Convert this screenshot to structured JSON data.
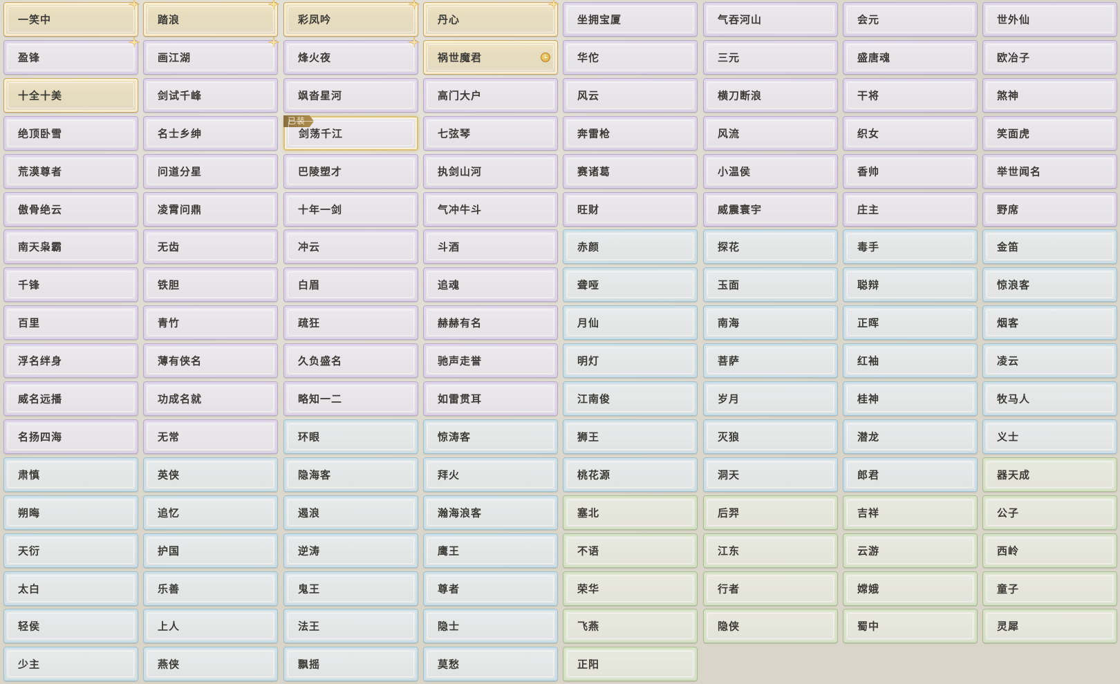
{
  "icons": {
    "sparkle": "sparkle-icon",
    "timer": "clock-icon"
  },
  "equipped_label": "已装",
  "colors": {
    "gold": "#caa563",
    "purple": "#b9a9c9",
    "blue": "#9fbfcd",
    "green": "#a8bd92",
    "badge": "#8a6f3d"
  },
  "titles": [
    {
      "label": "一笑中",
      "rarity": "gold",
      "sparkle": true
    },
    {
      "label": "踏浪",
      "rarity": "gold",
      "sparkle": true
    },
    {
      "label": "彩凤吟",
      "rarity": "gold",
      "sparkle": true
    },
    {
      "label": "丹心",
      "rarity": "gold",
      "sparkle": true
    },
    {
      "label": "坐拥宝厦",
      "rarity": "purple"
    },
    {
      "label": "气吞河山",
      "rarity": "purple"
    },
    {
      "label": "会元",
      "rarity": "purple"
    },
    {
      "label": "世外仙",
      "rarity": "purple"
    },
    {
      "label": "盈锋",
      "rarity": "purple",
      "sparkle": true
    },
    {
      "label": "画江湖",
      "rarity": "purple",
      "sparkle": true
    },
    {
      "label": "烽火夜",
      "rarity": "purple",
      "sparkle": true
    },
    {
      "label": "祸世魔君",
      "rarity": "gold",
      "timer": true
    },
    {
      "label": "华佗",
      "rarity": "purple"
    },
    {
      "label": "三元",
      "rarity": "purple"
    },
    {
      "label": "盛唐魂",
      "rarity": "purple"
    },
    {
      "label": "欧冶子",
      "rarity": "purple"
    },
    {
      "label": "十全十美",
      "rarity": "gold"
    },
    {
      "label": "剑试千峰",
      "rarity": "purple"
    },
    {
      "label": "飒沓星河",
      "rarity": "purple"
    },
    {
      "label": "高门大户",
      "rarity": "purple"
    },
    {
      "label": "风云",
      "rarity": "purple"
    },
    {
      "label": "横刀断浪",
      "rarity": "purple"
    },
    {
      "label": "干将",
      "rarity": "purple"
    },
    {
      "label": "煞神",
      "rarity": "purple"
    },
    {
      "label": "绝顶卧雪",
      "rarity": "purple"
    },
    {
      "label": "名士乡绅",
      "rarity": "purple"
    },
    {
      "label": "剑荡千江",
      "rarity": "purple",
      "equipped": true
    },
    {
      "label": "七弦琴",
      "rarity": "purple"
    },
    {
      "label": "奔雷枪",
      "rarity": "purple"
    },
    {
      "label": "风流",
      "rarity": "purple"
    },
    {
      "label": "织女",
      "rarity": "purple"
    },
    {
      "label": "笑面虎",
      "rarity": "purple"
    },
    {
      "label": "荒漠尊者",
      "rarity": "purple"
    },
    {
      "label": "问道分星",
      "rarity": "purple"
    },
    {
      "label": "巴陵塑才",
      "rarity": "purple"
    },
    {
      "label": "执剑山河",
      "rarity": "purple"
    },
    {
      "label": "赛诸葛",
      "rarity": "purple"
    },
    {
      "label": "小温侯",
      "rarity": "purple"
    },
    {
      "label": "香帅",
      "rarity": "purple"
    },
    {
      "label": "举世闻名",
      "rarity": "purple"
    },
    {
      "label": "傲骨绝云",
      "rarity": "purple"
    },
    {
      "label": "凌霄问鼎",
      "rarity": "purple"
    },
    {
      "label": "十年一剑",
      "rarity": "purple"
    },
    {
      "label": "气冲牛斗",
      "rarity": "purple"
    },
    {
      "label": "旺财",
      "rarity": "purple"
    },
    {
      "label": "威震寰宇",
      "rarity": "purple"
    },
    {
      "label": "庄主",
      "rarity": "purple"
    },
    {
      "label": "野席",
      "rarity": "purple"
    },
    {
      "label": "南天枭霸",
      "rarity": "purple"
    },
    {
      "label": "无齿",
      "rarity": "purple"
    },
    {
      "label": "冲云",
      "rarity": "purple"
    },
    {
      "label": "斗酒",
      "rarity": "purple"
    },
    {
      "label": "赤颜",
      "rarity": "blue"
    },
    {
      "label": "探花",
      "rarity": "blue"
    },
    {
      "label": "毒手",
      "rarity": "blue"
    },
    {
      "label": "金笛",
      "rarity": "blue"
    },
    {
      "label": "千锋",
      "rarity": "purple"
    },
    {
      "label": "铁胆",
      "rarity": "purple"
    },
    {
      "label": "白眉",
      "rarity": "purple"
    },
    {
      "label": "追魂",
      "rarity": "purple"
    },
    {
      "label": "聋哑",
      "rarity": "blue"
    },
    {
      "label": "玉面",
      "rarity": "blue"
    },
    {
      "label": "聪辩",
      "rarity": "blue"
    },
    {
      "label": "惊浪客",
      "rarity": "blue"
    },
    {
      "label": "百里",
      "rarity": "purple"
    },
    {
      "label": "青竹",
      "rarity": "purple"
    },
    {
      "label": "疏狂",
      "rarity": "purple"
    },
    {
      "label": "赫赫有名",
      "rarity": "purple"
    },
    {
      "label": "月仙",
      "rarity": "blue"
    },
    {
      "label": "南海",
      "rarity": "blue"
    },
    {
      "label": "正晖",
      "rarity": "blue"
    },
    {
      "label": "烟客",
      "rarity": "blue"
    },
    {
      "label": "浮名绊身",
      "rarity": "purple"
    },
    {
      "label": "薄有侠名",
      "rarity": "purple"
    },
    {
      "label": "久负盛名",
      "rarity": "purple"
    },
    {
      "label": "驰声走誉",
      "rarity": "purple"
    },
    {
      "label": "明灯",
      "rarity": "blue"
    },
    {
      "label": "菩萨",
      "rarity": "blue"
    },
    {
      "label": "红袖",
      "rarity": "blue"
    },
    {
      "label": "凌云",
      "rarity": "blue"
    },
    {
      "label": "威名远播",
      "rarity": "purple"
    },
    {
      "label": "功成名就",
      "rarity": "purple"
    },
    {
      "label": "略知一二",
      "rarity": "purple"
    },
    {
      "label": "如雷贯耳",
      "rarity": "purple"
    },
    {
      "label": "江南俊",
      "rarity": "blue"
    },
    {
      "label": "岁月",
      "rarity": "blue"
    },
    {
      "label": "桂神",
      "rarity": "blue"
    },
    {
      "label": "牧马人",
      "rarity": "blue"
    },
    {
      "label": "名扬四海",
      "rarity": "purple"
    },
    {
      "label": "无常",
      "rarity": "purple"
    },
    {
      "label": "环眼",
      "rarity": "blue"
    },
    {
      "label": "惊涛客",
      "rarity": "blue"
    },
    {
      "label": "狮王",
      "rarity": "blue"
    },
    {
      "label": "灭狼",
      "rarity": "blue"
    },
    {
      "label": "潜龙",
      "rarity": "blue"
    },
    {
      "label": "义士",
      "rarity": "blue"
    },
    {
      "label": "肃慎",
      "rarity": "blue"
    },
    {
      "label": "英侠",
      "rarity": "blue"
    },
    {
      "label": "隐海客",
      "rarity": "blue"
    },
    {
      "label": "拜火",
      "rarity": "blue"
    },
    {
      "label": "桃花源",
      "rarity": "blue"
    },
    {
      "label": "洞天",
      "rarity": "blue"
    },
    {
      "label": "郎君",
      "rarity": "blue"
    },
    {
      "label": "器天成",
      "rarity": "green"
    },
    {
      "label": "朔晦",
      "rarity": "blue"
    },
    {
      "label": "追忆",
      "rarity": "blue"
    },
    {
      "label": "遏浪",
      "rarity": "blue"
    },
    {
      "label": "瀚海浪客",
      "rarity": "blue"
    },
    {
      "label": "塞北",
      "rarity": "green"
    },
    {
      "label": "后羿",
      "rarity": "green"
    },
    {
      "label": "吉祥",
      "rarity": "green"
    },
    {
      "label": "公子",
      "rarity": "green"
    },
    {
      "label": "天衍",
      "rarity": "blue"
    },
    {
      "label": "护国",
      "rarity": "blue"
    },
    {
      "label": "逆涛",
      "rarity": "blue"
    },
    {
      "label": "鹰王",
      "rarity": "blue"
    },
    {
      "label": "不语",
      "rarity": "green"
    },
    {
      "label": "江东",
      "rarity": "green"
    },
    {
      "label": "云游",
      "rarity": "green"
    },
    {
      "label": "西岭",
      "rarity": "green"
    },
    {
      "label": "太白",
      "rarity": "blue"
    },
    {
      "label": "乐善",
      "rarity": "blue"
    },
    {
      "label": "鬼王",
      "rarity": "blue"
    },
    {
      "label": "尊者",
      "rarity": "blue"
    },
    {
      "label": "荣华",
      "rarity": "green"
    },
    {
      "label": "行者",
      "rarity": "green"
    },
    {
      "label": "嫦娥",
      "rarity": "green"
    },
    {
      "label": "童子",
      "rarity": "green"
    },
    {
      "label": "轻侯",
      "rarity": "blue"
    },
    {
      "label": "上人",
      "rarity": "blue"
    },
    {
      "label": "法王",
      "rarity": "blue"
    },
    {
      "label": "隐士",
      "rarity": "blue"
    },
    {
      "label": "飞燕",
      "rarity": "green"
    },
    {
      "label": "隐侠",
      "rarity": "green"
    },
    {
      "label": "蜀中",
      "rarity": "green"
    },
    {
      "label": "灵犀",
      "rarity": "green"
    },
    {
      "label": "少主",
      "rarity": "blue"
    },
    {
      "label": "燕侠",
      "rarity": "blue"
    },
    {
      "label": "飘摇",
      "rarity": "blue"
    },
    {
      "label": "莫愁",
      "rarity": "blue"
    },
    {
      "label": "正阳",
      "rarity": "green"
    }
  ]
}
